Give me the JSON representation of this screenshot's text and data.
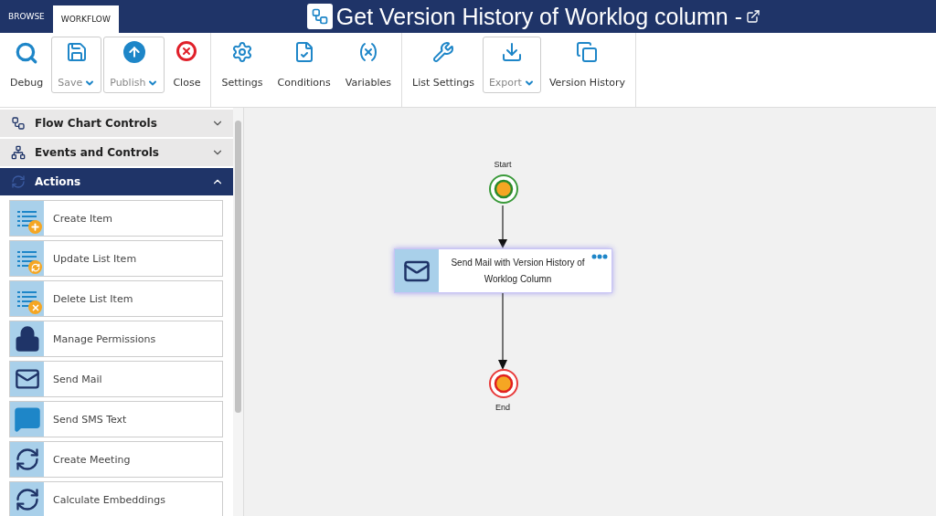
{
  "tabs": [
    {
      "label": "BROWSE",
      "selected": false
    },
    {
      "label": "WORKFLOW",
      "selected": true
    }
  ],
  "title": {
    "text": "Get Version History of Worklog column -"
  },
  "toolbar": {
    "groups": [
      {
        "items": [
          {
            "label": "Debug",
            "kind": "plain"
          },
          {
            "label": "Save",
            "kind": "dropdown"
          },
          {
            "label": "Publish",
            "kind": "dropdown"
          },
          {
            "label": "Close",
            "kind": "plain"
          }
        ]
      },
      {
        "items": [
          {
            "label": "Settings",
            "kind": "plain"
          },
          {
            "label": "Conditions",
            "kind": "plain"
          },
          {
            "label": "Variables",
            "kind": "plain"
          }
        ]
      },
      {
        "items": [
          {
            "label": "List Settings",
            "kind": "plain"
          },
          {
            "label": "Export",
            "kind": "dropdown"
          },
          {
            "label": "Version History",
            "kind": "plain"
          }
        ]
      }
    ]
  },
  "sidebar": {
    "sections": [
      {
        "label": "Flow Chart Controls",
        "expanded": false
      },
      {
        "label": "Events and Controls",
        "expanded": false
      },
      {
        "label": "Actions",
        "expanded": true,
        "items": [
          "Create Item",
          "Update List Item",
          "Delete List Item",
          "Manage Permissions",
          "Send Mail",
          "Send SMS Text",
          "Create Meeting",
          "Calculate Embeddings"
        ]
      }
    ]
  },
  "canvas": {
    "start_label": "Start",
    "node_label": "Send Mail with Version History of Worklog Column",
    "end_label": "End"
  }
}
